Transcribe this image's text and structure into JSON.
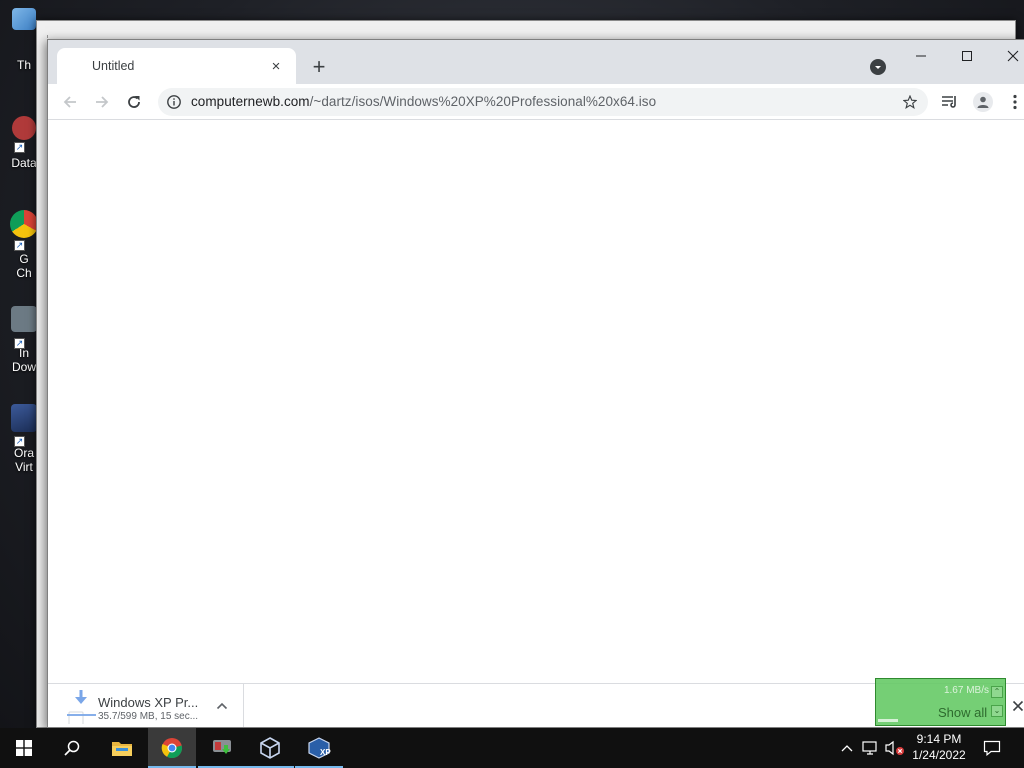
{
  "desktop": {
    "icons": [
      {
        "label": "Th",
        "icon": "recycle-bin-icon"
      },
      {
        "label": "Data",
        "icon": "database-app-icon"
      },
      {
        "label": "G\nCh",
        "icon": "google-chrome-icon"
      },
      {
        "label": "In\nDow",
        "icon": "internet-download-manager-icon"
      },
      {
        "label": "Ora\nVirt",
        "icon": "oracle-virtualbox-icon"
      }
    ]
  },
  "browser": {
    "tab_title": "Untitled",
    "tab_close": "×",
    "new_tab": "+",
    "window_controls": {
      "minimize": "minimize-icon",
      "maximize": "maximize-icon",
      "close": "close-icon"
    },
    "url_host": "computernewb.com",
    "url_path": "/~dartz/isos/Windows%20XP%20Professional%20x64.iso",
    "accent": "#1a73e8"
  },
  "downloads": {
    "item_name": "Windows XP Pr...",
    "item_status": "35.7/599 MB, 15 sec...",
    "progress_fraction": 0.06
  },
  "download_manager_widget": {
    "speed": "1.67 MB/s",
    "show_all": "Show all",
    "color": "#62c862"
  },
  "taskbar": {
    "apps": [
      "start",
      "search",
      "file-explorer",
      "chrome",
      "internet-download-manager",
      "virtualbox",
      "windows-xp-vm"
    ],
    "time": "9:14 PM",
    "date": "1/24/2022"
  }
}
